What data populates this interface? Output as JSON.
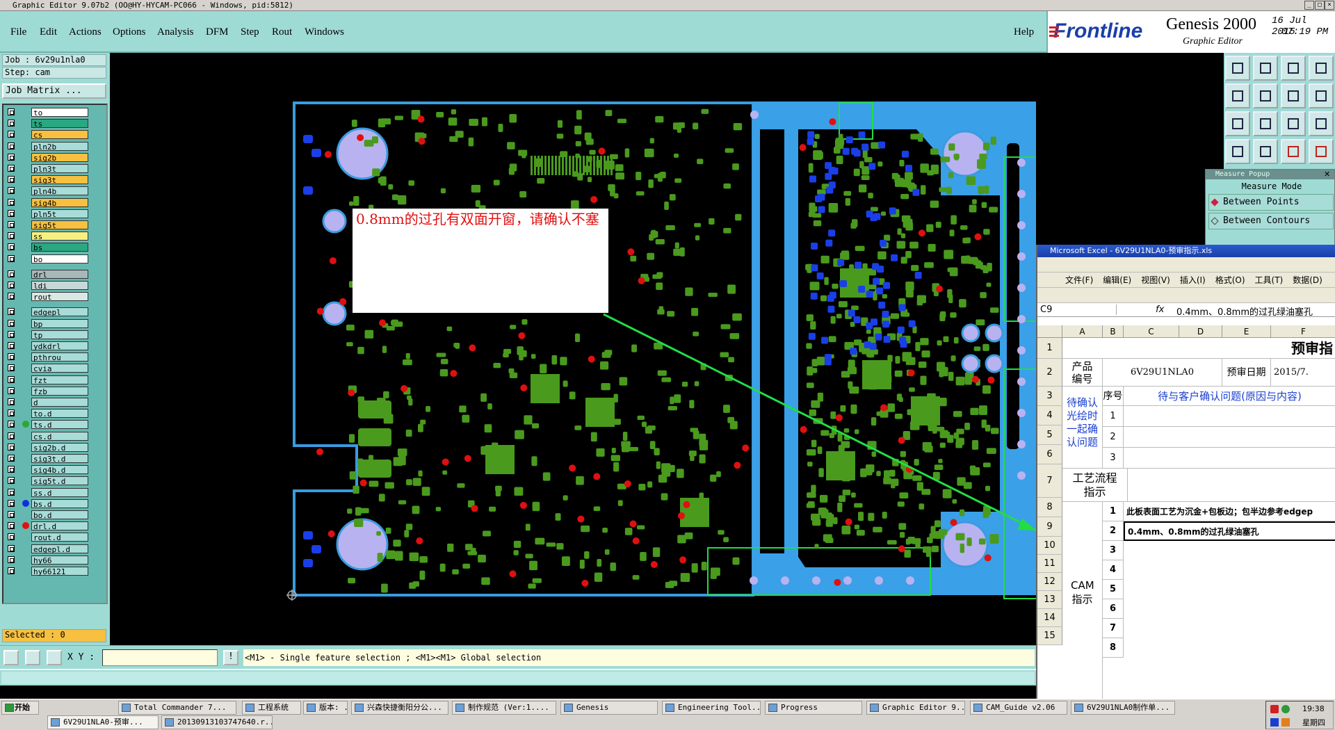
{
  "window": {
    "title": "Graphic Editor 9.07b2 (OO@HY-HYCAM-PC066 - Windows, pid:5812)"
  },
  "menu": {
    "items": [
      "File",
      "Edit",
      "Actions",
      "Options",
      "Analysis",
      "DFM",
      "Step",
      "Rout",
      "Windows"
    ],
    "help": "Help"
  },
  "logo": {
    "brand": "Frontline",
    "product": "Genesis 2000",
    "subtitle": "Graphic Editor",
    "date": "16 Jul 2015",
    "time": "07:19 PM"
  },
  "left_panel": {
    "job": "Job : 6v29u1nla0",
    "step": "Step: cam",
    "job_matrix_button": "Job Matrix ...",
    "selected": "Selected : 0",
    "layers": [
      {
        "name": "to",
        "color": "#ffffff",
        "dot": ""
      },
      {
        "name": "ts",
        "color": "#2aa87f",
        "dot": ""
      },
      {
        "name": "cs",
        "color": "#f7c040",
        "dot": ""
      },
      {
        "name": "pln2b",
        "color": "#a8dcd8",
        "dot": ""
      },
      {
        "name": "sig2b",
        "color": "#f7c040",
        "dot": ""
      },
      {
        "name": "pln3t",
        "color": "#a8dcd8",
        "dot": ""
      },
      {
        "name": "sig3t",
        "color": "#f7c040",
        "dot": ""
      },
      {
        "name": "pln4b",
        "color": "#a8dcd8",
        "dot": ""
      },
      {
        "name": "sig4b",
        "color": "#f7c040",
        "dot": ""
      },
      {
        "name": "pln5t",
        "color": "#a8dcd8",
        "dot": ""
      },
      {
        "name": "sig5t",
        "color": "#f7c040",
        "dot": ""
      },
      {
        "name": "ss",
        "color": "#f7f080",
        "dot": ""
      },
      {
        "name": "bs",
        "color": "#2aa87f",
        "dot": ""
      },
      {
        "name": "bo",
        "color": "#ffffff",
        "dot": ""
      },
      {
        "name": "drl",
        "color": "#a8b8b8",
        "dot": ""
      },
      {
        "name": "ldi",
        "color": "#c8d8d8",
        "dot": ""
      },
      {
        "name": "rout",
        "color": "#d8e8e4",
        "dot": ""
      },
      {
        "name": "edgepl",
        "color": "#a8dcd8",
        "dot": ""
      },
      {
        "name": "bp",
        "color": "#a8dcd8",
        "dot": ""
      },
      {
        "name": "tp",
        "color": "#a8dcd8",
        "dot": ""
      },
      {
        "name": "ydkdrl",
        "color": "#a8dcd8",
        "dot": ""
      },
      {
        "name": "pthrou",
        "color": "#a8dcd8",
        "dot": ""
      },
      {
        "name": "cvia",
        "color": "#a8dcd8",
        "dot": ""
      },
      {
        "name": "fzt",
        "color": "#a8dcd8",
        "dot": ""
      },
      {
        "name": "fzb",
        "color": "#a8dcd8",
        "dot": ""
      },
      {
        "name": "d",
        "color": "#a8dcd8",
        "dot": ""
      },
      {
        "name": "to.d",
        "color": "#a8dcd8",
        "dot": ""
      },
      {
        "name": "ts.d",
        "color": "#a8dcd8",
        "dot": "#2aa830"
      },
      {
        "name": "cs.d",
        "color": "#a8dcd8",
        "dot": ""
      },
      {
        "name": "sig2b.d",
        "color": "#a8dcd8",
        "dot": ""
      },
      {
        "name": "sig3t.d",
        "color": "#a8dcd8",
        "dot": ""
      },
      {
        "name": "sig4b.d",
        "color": "#a8dcd8",
        "dot": ""
      },
      {
        "name": "sig5t.d",
        "color": "#a8dcd8",
        "dot": ""
      },
      {
        "name": "ss.d",
        "color": "#a8dcd8",
        "dot": ""
      },
      {
        "name": "bs.d",
        "color": "#a8dcd8",
        "dot": "#1030e0"
      },
      {
        "name": "bo.d",
        "color": "#a8dcd8",
        "dot": ""
      },
      {
        "name": "drl.d",
        "color": "#a8dcd8",
        "dot": "#e01010"
      },
      {
        "name": "rout.d",
        "color": "#a8dcd8",
        "dot": ""
      },
      {
        "name": "edgepl.d",
        "color": "#a8dcd8",
        "dot": ""
      },
      {
        "name": "hy66",
        "color": "#a8dcd8",
        "dot": ""
      },
      {
        "name": "hy66121",
        "color": "#a8dcd8",
        "dot": ""
      }
    ]
  },
  "canvas": {
    "annotation": "0.8mm的过孔有双面开窗，请确认不塞"
  },
  "bottom": {
    "xy_label": "X Y :",
    "xy_value": "",
    "hint": "<M1> - Single feature selection ; <M1><M1> Global selection"
  },
  "measure_popup": {
    "title": "Measure Popup",
    "mode": "Measure Mode",
    "options": [
      "Between Points",
      "Between Contours"
    ]
  },
  "excel": {
    "title": "Microsoft Excel - 6V29U1NLA0-预审指示.xls",
    "menu": [
      "文件(F)",
      "编辑(E)",
      "视图(V)",
      "插入(I)",
      "格式(O)",
      "工具(T)",
      "数据(D)"
    ],
    "name_box": "C9",
    "formula": "0.4mm、0.8mm的过孔绿油塞孔",
    "columns": [
      "A",
      "B",
      "C",
      "D",
      "E",
      "F"
    ],
    "row_numbers": [
      "1",
      "2",
      "3",
      "4",
      "5",
      "6",
      "7",
      "8",
      "9",
      "10",
      "11",
      "12",
      "13",
      "14",
      "15"
    ],
    "header_title": "预审指",
    "product_label": "产品编号",
    "product_value": "6V29U1NLA0",
    "date_label": "预审日期",
    "date_value": "2015/7.",
    "seq_label": "序号",
    "confirm_header": "待与客户确认问题(原因与内容)",
    "confirm_group": "待确认光绘时一起确认问题",
    "process_group": "工艺流程指示",
    "cam_group": "CAM指示",
    "seq_numbers_a": [
      "1",
      "2",
      "3"
    ],
    "seq_numbers_b": [
      "1",
      "2",
      "3",
      "4",
      "5",
      "6",
      "7",
      "8"
    ],
    "cam_line1": "此板表面工艺为沉金+包板边；包半边参考edgep",
    "cam_line2": "0.4mm、0.8mm的过孔绿油塞孔"
  },
  "taskbar": {
    "start": "开始",
    "row1": [
      "Total Commander 7...",
      "工程系统",
      "版本: ...",
      "兴森快捷衡阳分公...",
      "制作规范 (Ver:1....",
      "Genesis",
      "Engineering Tool...",
      "Progress",
      "Graphic Editor 9...",
      "CAM_Guide v2.06",
      "6V29U1NLA0制作单..."
    ],
    "row2": [
      "6V29U1NLA0-预审...",
      "20130913103747640.r..."
    ],
    "clock": "19:38",
    "weekday": "星期四"
  }
}
